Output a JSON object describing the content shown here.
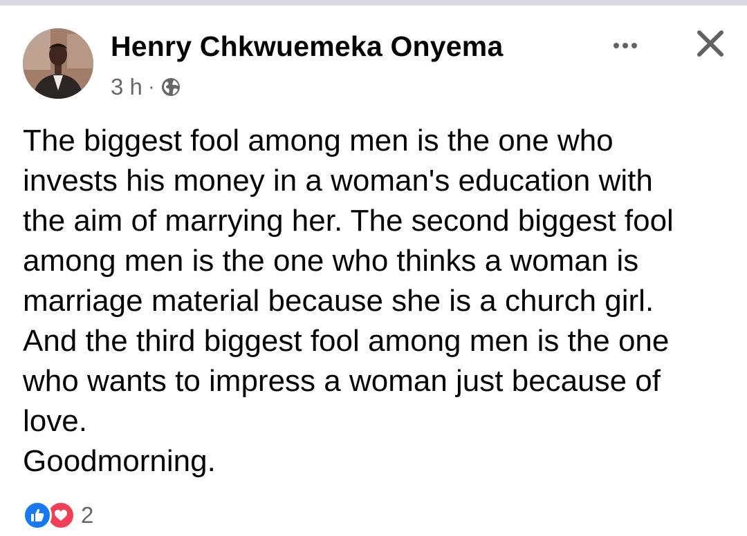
{
  "post": {
    "author": "Henry Chkwuemeka Onyema",
    "timestamp": "3 h",
    "separator": "·",
    "visibility_icon": "globe-icon",
    "body_lines": [
      "The biggest fool among men is the one who",
      "invests his money in a woman's education with",
      "the aim of marrying her. The second biggest fool",
      "among men is the one who thinks a woman is",
      "marriage material because she is a church girl.",
      "And the third biggest fool among men is the one",
      "who wants to impress a woman just because of",
      "love.",
      "Goodmorning."
    ],
    "reactions": {
      "icons": [
        "like-icon",
        "love-icon"
      ],
      "count": "2"
    }
  },
  "colors": {
    "like": "#1877f2",
    "love": "#f33e58",
    "secondary_text": "#65676b"
  }
}
